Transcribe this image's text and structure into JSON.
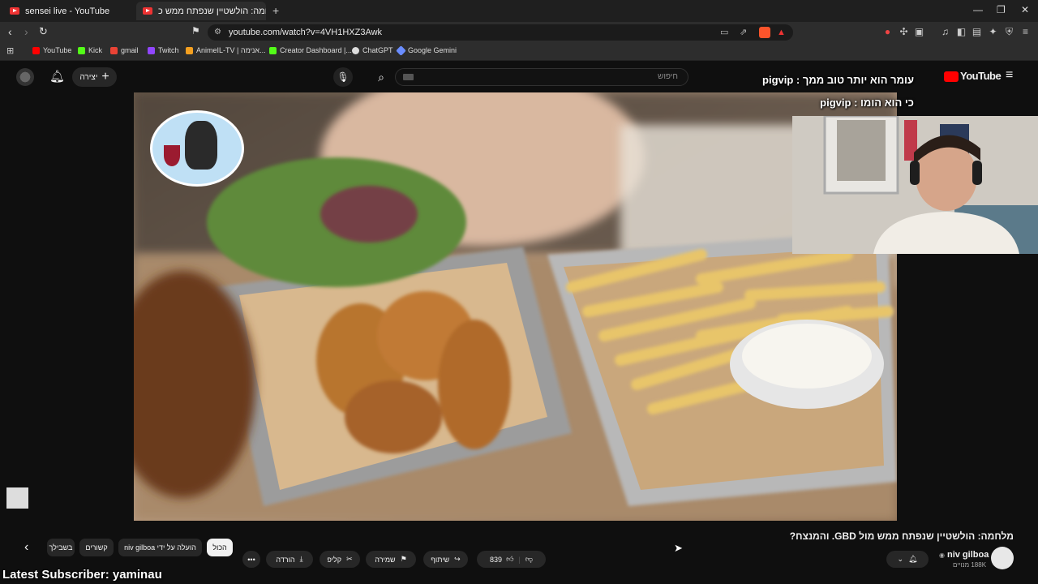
{
  "browser": {
    "tabs": [
      {
        "title": "sensei live - YouTube",
        "active": false
      },
      {
        "title": "מלחמה: הולשטיין שנפתח ממש כ",
        "active": true
      }
    ],
    "new_tab": "+",
    "url": "youtube.com/watch?v=4VH1HXZ3Awk",
    "bookmarks": [
      {
        "label": "YouTube",
        "color": "#ff0000"
      },
      {
        "label": "Kick",
        "color": "#53fc18"
      },
      {
        "label": "gmail",
        "color": "#ea4335"
      },
      {
        "label": "Twitch",
        "color": "#9146ff"
      },
      {
        "label": "AnimeIL-TV | אנימה...",
        "color": "#f4a020"
      },
      {
        "label": "Creator Dashboard |...",
        "color": "#e0e0e0"
      },
      {
        "label": "ChatGPT",
        "color": "#dddddd"
      },
      {
        "label": "Google Gemini",
        "color": "#6a8dff"
      }
    ]
  },
  "youtube": {
    "logo": "YouTube",
    "search_placeholder": "חיפוש",
    "create_label": "יצירה"
  },
  "stream_overlay": {
    "line1": "עומר הוא יותר טוב ממך : pigvip",
    "line2": "כי הוא הומו : pigvip",
    "latest_subscriber": "Latest Subscriber: yaminau"
  },
  "video": {
    "title": "מלחמה: הולשטיין שנפתח ממש מול GBD. והמנצח?",
    "channel": "niv gilboa",
    "subscribers": "188K מנויים",
    "likes": "839",
    "actions": {
      "share": "שיתוף",
      "save": "שמירה",
      "clip": "קליפ",
      "download": "הורדה"
    }
  },
  "chips": {
    "all": "הכול",
    "by_channel": "הועלה על ידי niv gilboa",
    "related": "קשורים",
    "for_you": "בשבילך"
  },
  "colors": {
    "background": "#0f0f0f",
    "chip_bg": "#272727",
    "chip_active": "#f1f1f1",
    "youtube_red": "#ff0000"
  }
}
